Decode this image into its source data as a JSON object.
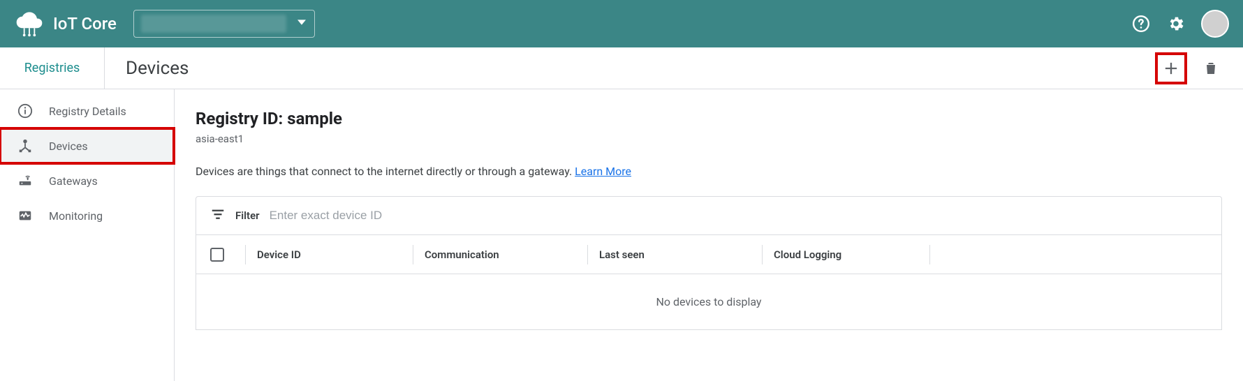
{
  "header": {
    "product": "IoT Core",
    "project_placeholder": ""
  },
  "subheader": {
    "breadcrumb": "Registries",
    "title": "Devices"
  },
  "sidebar": {
    "items": [
      {
        "label": "Registry Details"
      },
      {
        "label": "Devices"
      },
      {
        "label": "Gateways"
      },
      {
        "label": "Monitoring"
      }
    ]
  },
  "main": {
    "registry_id_label": "Registry ID: sample",
    "region": "asia-east1",
    "description_text": "Devices are things that connect to the internet directly or through a gateway. ",
    "learn_more": "Learn More",
    "filter_label": "Filter",
    "filter_placeholder": "Enter exact device ID",
    "columns": {
      "device_id": "Device ID",
      "communication": "Communication",
      "last_seen": "Last seen",
      "cloud_logging": "Cloud Logging"
    },
    "empty_message": "No devices to display"
  }
}
